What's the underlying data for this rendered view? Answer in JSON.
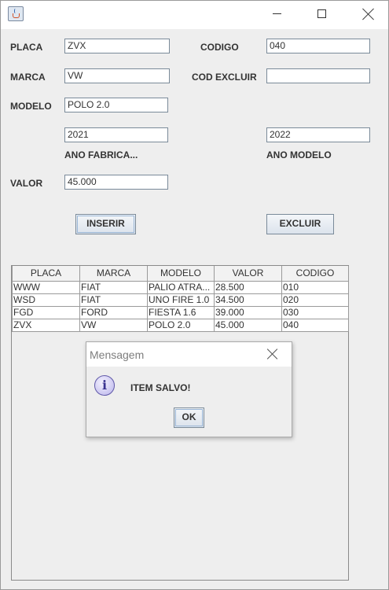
{
  "window": {
    "controls": {
      "minimize_icon": "minimize-icon",
      "maximize_icon": "maximize-icon",
      "close_icon": "close-icon"
    }
  },
  "form": {
    "placa_label": "PLACA",
    "placa_value": "ZVX",
    "marca_label": "MARCA",
    "marca_value": "VW",
    "modelo_label": "MODELO",
    "modelo_value": "POLO 2.0",
    "ano_fabrica_value": "2021",
    "ano_fabrica_label": "ANO FABRICA...",
    "valor_label": "VALOR",
    "valor_value": "45.000",
    "codigo_label": "CODIGO",
    "codigo_value": "040",
    "cod_excluir_label": "COD EXCLUIR",
    "cod_excluir_value": "",
    "ano_modelo_value": "2022",
    "ano_modelo_label": "ANO MODELO",
    "inserir_label": "INSERIR",
    "excluir_label": "EXCLUIR"
  },
  "table": {
    "headers": [
      "PLACA",
      "MARCA",
      "MODELO",
      "VALOR",
      "CODIGO"
    ],
    "rows": [
      [
        "WWW",
        "FIAT",
        "PALIO ATRA...",
        "28.500",
        "010"
      ],
      [
        "WSD",
        "FIAT",
        "UNO FIRE 1.0",
        "34.500",
        "020"
      ],
      [
        "FGD",
        "FORD",
        "FIESTA 1.6",
        "39.000",
        "030"
      ],
      [
        "ZVX",
        "VW",
        "POLO 2.0",
        "45.000",
        "040"
      ]
    ]
  },
  "dialog": {
    "title": "Mensagem",
    "message": "ITEM SALVO!",
    "ok_label": "OK",
    "icon": "info-icon",
    "icon_glyph": "i"
  }
}
